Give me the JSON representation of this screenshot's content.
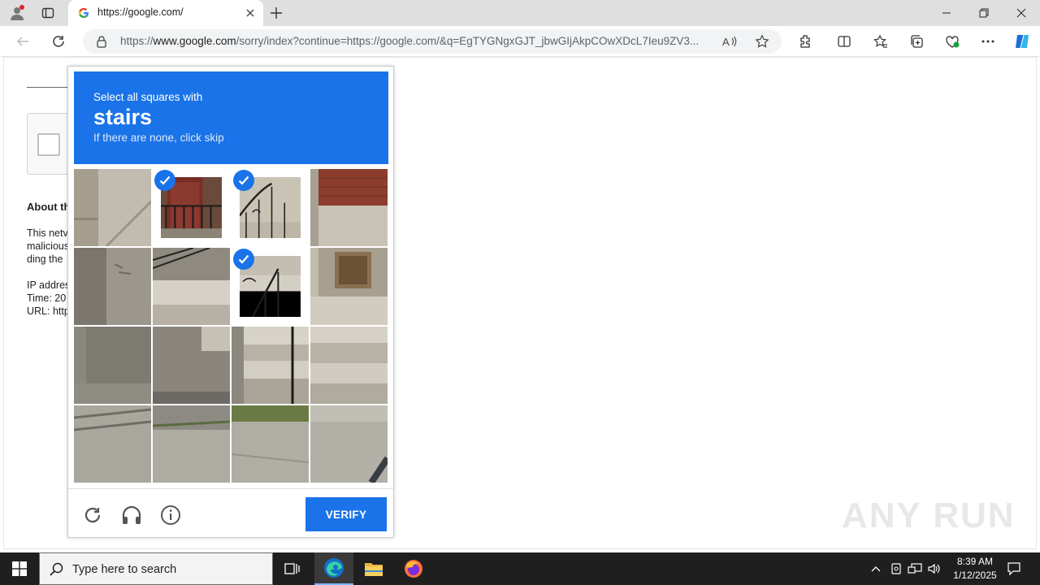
{
  "browser": {
    "tab_title": "https://google.com/",
    "url_scheme": "https://",
    "url_host": "www.google.com",
    "url_rest": "/sorry/index?continue=https://google.com/&q=EgTYGNgxGJT_jbwGIjAkpCOwXDcL7Ieu9ZV3..."
  },
  "page": {
    "about_heading": "About th",
    "para_lines": [
      "This netv",
      "malicious",
      "ding the"
    ],
    "ip_line": "IP addres",
    "time_line": "Time: 20",
    "url_line": "URL: http"
  },
  "captcha": {
    "instruction": "Select all squares with",
    "target_word": "stairs",
    "hint": "If there are none, click skip",
    "verify_label": "VERIFY",
    "selected_tiles": [
      1,
      2,
      6
    ],
    "colors": {
      "brand_blue": "#1a73e8"
    }
  },
  "watermark": "ANY RUN",
  "taskbar": {
    "search_placeholder": "Type here to search",
    "time": "8:39 AM",
    "date": "1/12/2025"
  }
}
